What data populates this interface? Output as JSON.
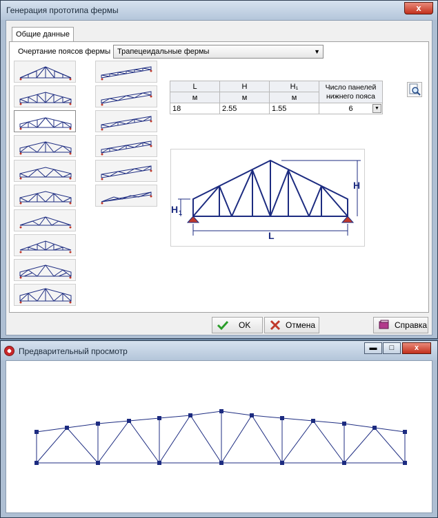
{
  "dialog": {
    "title": "Генерация прототипа фермы",
    "close_label": "x",
    "tab_label": "Общие данные",
    "outline_label": "Очертание поясов фермы",
    "outline_value": "Трапецеидальные фермы",
    "outline_arrow": "▼",
    "table": {
      "headers": [
        "L",
        "H",
        "H₁",
        "Число панелей нижнего пояса"
      ],
      "units": [
        "м",
        "м",
        "м"
      ],
      "values": [
        "18",
        "2.55",
        "1.55",
        "6"
      ],
      "dropdown_arrow": "▼"
    },
    "diagram_labels": {
      "H": "H",
      "H1": "H",
      "H1_sub": "1",
      "L": "L"
    },
    "buttons": {
      "ok": "OK",
      "cancel": "Отмена",
      "help": "Справка"
    },
    "colors": {
      "truss": "#1c2b80",
      "support": "#c0392b",
      "ok_icon": "#2a9d2a",
      "cancel_icon": "#c0392b"
    }
  },
  "preview": {
    "title": "Предварительный просмотр",
    "minimize": "▬",
    "maximize": "□",
    "close": "x"
  }
}
